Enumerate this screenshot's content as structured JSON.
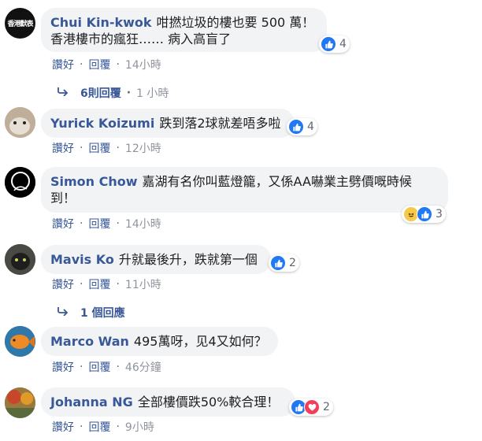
{
  "comments": [
    {
      "author": "Chui Kin-kwok",
      "avatar_text": "香港默表",
      "text_line1": "咁撚垃圾的樓也要 500 萬！",
      "text_line2": "香港樓市的瘋狂…… 病入高盲了",
      "reaction_count": "4",
      "like_label": "讚好",
      "reply_label": "回覆",
      "time": "14小時",
      "replies_label": "6則回覆",
      "replies_time": "1 小時"
    },
    {
      "author": "Yurick Koizumi",
      "text": "跌到落2球就差唔多啦",
      "reaction_count": "4",
      "like_label": "讚好",
      "reply_label": "回覆",
      "time": "12小時"
    },
    {
      "author": "Simon Chow",
      "text_line1": "嘉湖有名你叫藍燈籠，又係AA嚇業主劈價嘅時候",
      "text_line2": "到！",
      "reaction_count": "3",
      "like_label": "讚好",
      "reply_label": "回覆",
      "time": "14小時"
    },
    {
      "author": "Mavis Ko",
      "text": "升就最後升，跌就第一個",
      "reaction_count": "2",
      "like_label": "讚好",
      "reply_label": "回覆",
      "time": "11小時",
      "replies_label": "1 個回應"
    },
    {
      "author": "Marco Wan",
      "text": "495萬呀，见4又如何？",
      "like_label": "讚好",
      "reply_label": "回覆",
      "time": "46分鐘"
    },
    {
      "author": "Johanna NG",
      "text": "全部樓價跌50%較合理！",
      "reaction_count": "2",
      "like_label": "讚好",
      "reply_label": "回覆",
      "time": "9小時"
    }
  ],
  "separator": "·",
  "colors": {
    "author": "#385898",
    "like": "#2078f4",
    "love": "#f33e58",
    "haha": "#f7c948",
    "bubble": "#f2f3f5"
  }
}
